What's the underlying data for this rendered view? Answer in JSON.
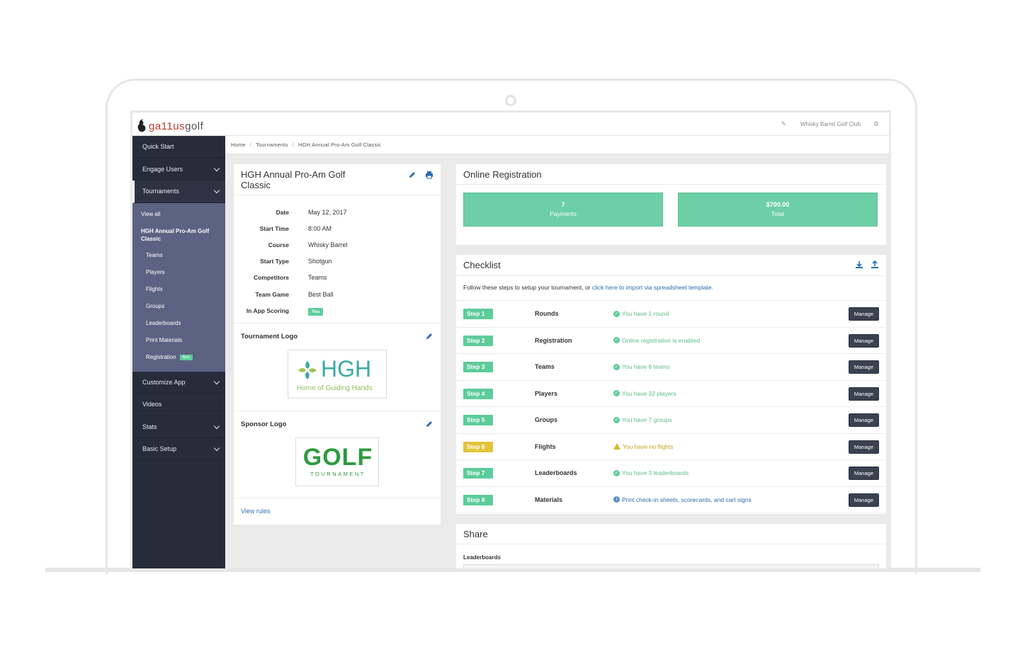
{
  "brand": {
    "part1": "ga11us",
    "part2": "golf"
  },
  "topbar": {
    "club_name": "Whisky Barrel Golf Club"
  },
  "breadcrumb": [
    "Home",
    "Tournaments",
    "HGH Annual Pro-Am Golf Classic"
  ],
  "sidebar": {
    "items": [
      {
        "label": "Quick Start"
      },
      {
        "label": "Engage Users"
      },
      {
        "label": "Tournaments"
      },
      {
        "label": "Customize App"
      },
      {
        "label": "Videos"
      },
      {
        "label": "Stats"
      },
      {
        "label": "Basic Setup"
      }
    ],
    "sub": {
      "view_all": "View all",
      "current": "HGH Annual Pro-Am Golf Classic",
      "children": [
        "Teams",
        "Players",
        "Flights",
        "Groups",
        "Leaderboards",
        "Print Materials",
        "Registration"
      ],
      "new_badge": "New"
    }
  },
  "tournament": {
    "title": "HGH Annual Pro-Am Golf Classic",
    "details": [
      {
        "label": "Date",
        "value": "May 12, 2017"
      },
      {
        "label": "Start Time",
        "value": "8:00 AM"
      },
      {
        "label": "Course",
        "value": "Whisky Barrel"
      },
      {
        "label": "Start Type",
        "value": "Shotgun"
      },
      {
        "label": "Competitors",
        "value": "Teams"
      },
      {
        "label": "Team Game",
        "value": "Best Ball"
      },
      {
        "label": "In App Scoring",
        "value": "Yes"
      }
    ],
    "tournament_logo_label": "Tournament Logo",
    "hgh_logo": {
      "word": "HGH",
      "tagline": "Home of Guiding Hands"
    },
    "sponsor_logo_label": "Sponsor Logo",
    "golf_logo": {
      "word": "GOLF",
      "sub": "TOURNAMENT"
    },
    "view_rules": "View rules"
  },
  "online_registration": {
    "title": "Online Registration",
    "payments": {
      "value": "7",
      "label": "Payments"
    },
    "total": {
      "value": "$700.00",
      "label": "Total"
    }
  },
  "checklist": {
    "title": "Checklist",
    "intro_text": "Follow these steps to setup your tournament, or ",
    "intro_link": "click here to import via spreadsheet template.",
    "manage_label": "Manage",
    "rows": [
      {
        "step": "Step 1",
        "name": "Rounds",
        "status": "You have 1 round",
        "kind": "ok"
      },
      {
        "step": "Step 2",
        "name": "Registration",
        "status": "Online registration is enabled",
        "kind": "ok"
      },
      {
        "step": "Step 3",
        "name": "Teams",
        "status": "You have 8 teams",
        "kind": "ok"
      },
      {
        "step": "Step 4",
        "name": "Players",
        "status": "You have 32 players",
        "kind": "ok"
      },
      {
        "step": "Step 5",
        "name": "Groups",
        "status": "You have 7 groups",
        "kind": "ok"
      },
      {
        "step": "Step 6",
        "name": "Flights",
        "status": "You have no flights",
        "kind": "warn"
      },
      {
        "step": "Step 7",
        "name": "Leaderboards",
        "status": "You have 3 leaderboards",
        "kind": "ok"
      },
      {
        "step": "Step 8",
        "name": "Materials",
        "status": "Print check-in sheets, scorecards, and cart signs",
        "kind": "info"
      }
    ]
  },
  "share": {
    "title": "Share",
    "leaderboards_label": "Leaderboards"
  },
  "colors": {
    "accent_green": "#6dcfa6",
    "sidebar_bg": "#272c3b",
    "sidebar_sub_bg": "#5c6282",
    "warn_yellow": "#e3c43b",
    "link_blue": "#2a6db0"
  }
}
